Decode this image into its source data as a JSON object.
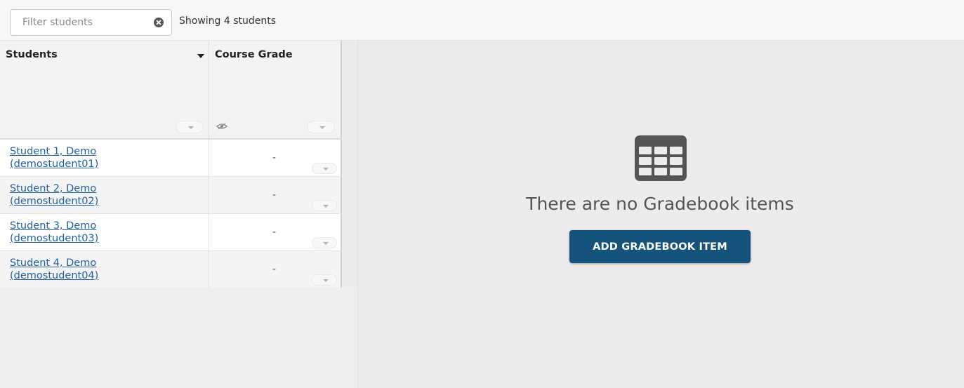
{
  "toolbar": {
    "filter_placeholder": "Filter students",
    "filter_value": "",
    "showing_text": "Showing 4 students"
  },
  "grid": {
    "columns": [
      {
        "label": "Students",
        "sort_icon": "caret-down-icon"
      },
      {
        "label": "Course Grade",
        "icon": "eye-slash-icon"
      }
    ],
    "rows": [
      {
        "name": "Student 1, Demo",
        "username": "(demostudent01)",
        "grade": "-"
      },
      {
        "name": "Student 2, Demo",
        "username": "(demostudent02)",
        "grade": "-"
      },
      {
        "name": "Student 3, Demo",
        "username": "(demostudent03)",
        "grade": "-"
      },
      {
        "name": "Student 4, Demo",
        "username": "(demostudent04)",
        "grade": "-"
      }
    ]
  },
  "empty_state": {
    "icon": "table-icon",
    "message": "There are no Gradebook items",
    "button_label": "ADD GRADEBOOK ITEM"
  },
  "colors": {
    "link": "#2261a4",
    "button": "#15537c",
    "icon": "#555555"
  }
}
